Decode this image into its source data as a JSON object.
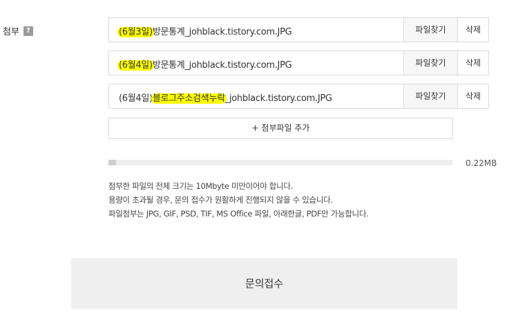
{
  "label": {
    "text": "첨부",
    "help_glyph": "?"
  },
  "files": [
    {
      "highlight": "(6월3일)",
      "rest": "방문통계_johblack.tistory.com.JPG",
      "find_label": "파일찾기",
      "delete_label": "삭제"
    },
    {
      "highlight": "(6월4일)",
      "rest": "방문통계_johblack.tistory.com.JPG",
      "find_label": "파일찾기",
      "delete_label": "삭제"
    },
    {
      "prefix": "(6월4일)",
      "highlight": "블로그주소검색누락",
      "rest": "_johblack.tistory.com.JPG",
      "find_label": "파일찾기",
      "delete_label": "삭제"
    }
  ],
  "add_button": "+ 첨부파일 추가",
  "usage": {
    "size_text": "0.22MB",
    "fraction": 0.022
  },
  "notes": [
    "첨부한 파일의 전체 크기는 10Mbyte 미만이어야 합니다.",
    "용량이 초과될 경우, 문의 접수가 원활하게 진행되지 않을 수 있습니다.",
    "파일첨부는 JPG, GIF, PSD, TIF, MS Office 파일, 아래한글, PDF만 가능합니다."
  ],
  "submit_label": "문의접수",
  "colors": {
    "highlight": "#ffff00",
    "border": "#d9d9d9",
    "submit_bg": "#efefef"
  }
}
